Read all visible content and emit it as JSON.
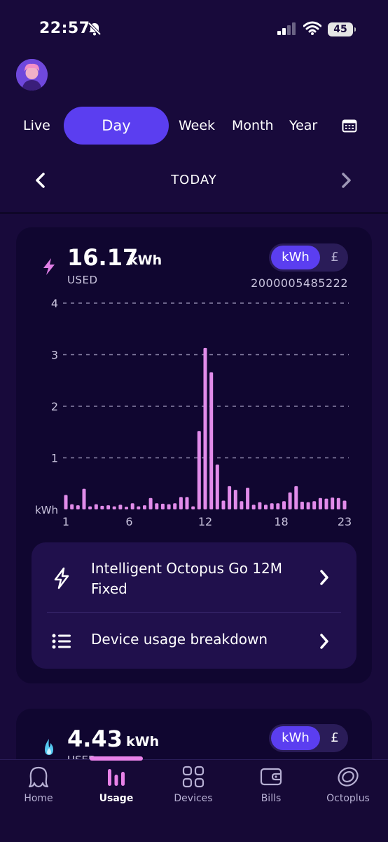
{
  "status_bar": {
    "time": "22:57",
    "battery": "45"
  },
  "tabs": [
    {
      "label": "Live",
      "active": false
    },
    {
      "label": "Day",
      "active": true
    },
    {
      "label": "Week",
      "active": false
    },
    {
      "label": "Month",
      "active": false
    },
    {
      "label": "Year",
      "active": false
    }
  ],
  "date_nav": {
    "label": "TODAY"
  },
  "electricity": {
    "value": "16.17",
    "unit": "kWh",
    "label": "USED",
    "meter_id": "2000005485222",
    "toggle": {
      "selected": "kWh",
      "other": "£"
    }
  },
  "chart_data": {
    "type": "bar",
    "ylabel": "kWh",
    "ylim": [
      0,
      4
    ],
    "yticks": [
      "4",
      "3",
      "2",
      "1"
    ],
    "xticks": [
      "1",
      "6",
      "12",
      "18",
      "23"
    ],
    "grid": true,
    "color": "#e28cea",
    "values": [
      0.28,
      0.1,
      0.08,
      0.4,
      0.06,
      0.1,
      0.07,
      0.08,
      0.06,
      0.09,
      0.05,
      0.12,
      0.06,
      0.08,
      0.22,
      0.12,
      0.11,
      0.1,
      0.12,
      0.24,
      0.24,
      0.06,
      1.52,
      3.13,
      2.66,
      0.87,
      0.17,
      0.45,
      0.38,
      0.16,
      0.42,
      0.09,
      0.14,
      0.09,
      0.12,
      0.12,
      0.16,
      0.33,
      0.45,
      0.15,
      0.14,
      0.16,
      0.22,
      0.21,
      0.23,
      0.22,
      0.17
    ]
  },
  "tariff": {
    "label": "Intelligent Octopus Go 12M Fixed"
  },
  "breakdown": {
    "label": "Device usage breakdown"
  },
  "gas": {
    "value": "4.43",
    "unit": "kWh",
    "label": "USED",
    "toggle": {
      "selected": "kWh",
      "other": "£"
    }
  },
  "nav": [
    {
      "label": "Home",
      "icon": "octopus-icon",
      "active": false
    },
    {
      "label": "Usage",
      "icon": "bar-chart-icon",
      "active": true
    },
    {
      "label": "Devices",
      "icon": "grid-icon",
      "active": false
    },
    {
      "label": "Bills",
      "icon": "wallet-icon",
      "active": false
    },
    {
      "label": "Octoplus",
      "icon": "octoplus-icon",
      "active": false
    }
  ],
  "colors": {
    "background": "#180a3b",
    "card": "#100630",
    "accent": "#5b3ef0",
    "bars": "#e28cea"
  }
}
